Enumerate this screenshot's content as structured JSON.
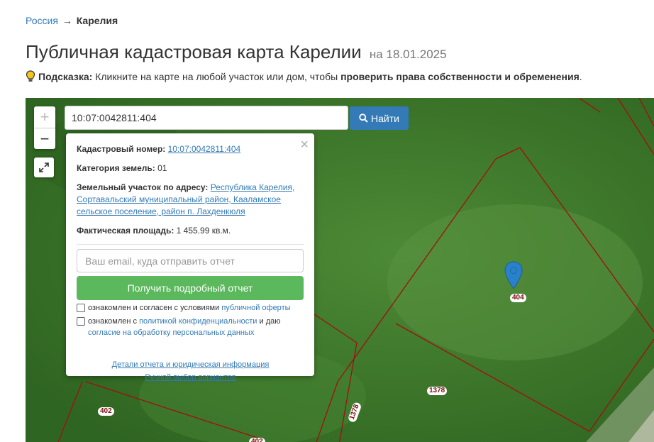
{
  "breadcrumb": {
    "root": "Россия",
    "separator": "→",
    "current": "Карелия"
  },
  "page": {
    "title": "Публичная кадастровая карта Карелии",
    "date": "на 18.01.2025"
  },
  "hint": {
    "label": "Подсказка:",
    "text": "Кликните на карте на любой участок или дом, чтобы",
    "strong": "проверить права собственности и обременения",
    "end": "."
  },
  "map": {
    "zoom_in": "+",
    "zoom_out": "−",
    "search": {
      "value": "10:07:0042811:404",
      "button": "Найти"
    },
    "parcel_labels": [
      "404",
      "1378",
      "1378",
      "402",
      "402"
    ],
    "colors": {
      "boundary": "#a01010",
      "button": "#337ab7",
      "report": "#5cb85c",
      "marker": "#2a81cb"
    }
  },
  "popup": {
    "close": "×",
    "cadastral_label": "Кадастровый номер:",
    "cadastral_value": "10:07:0042811:404",
    "category_label": "Категория земель:",
    "category_value": "01",
    "address_label": "Земельный участок по адресу:",
    "address_value": "Республика Карелия, Сортавальский муниципальный район, Каaламское сельское поселение, район п. Лахденкюля",
    "area_label": "Фактическая площадь:",
    "area_value": "1 455.99 кв.м.",
    "email_placeholder": "Ваш email, куда отправить отчет",
    "report_button": "Получить подробный отчет",
    "check1_text": "ознакомлен и согласен с условиями",
    "check1_link": "публичной оферты",
    "check2_text": "ознакомлен с",
    "check2_link": "политикой конфиденциальности",
    "check2_mid": "и даю",
    "check2_link2": "согласие на обработку персональных данных",
    "details_link": "Детали отчета и юридическая информация",
    "manual_link": "Ручной выбор вариантов"
  }
}
